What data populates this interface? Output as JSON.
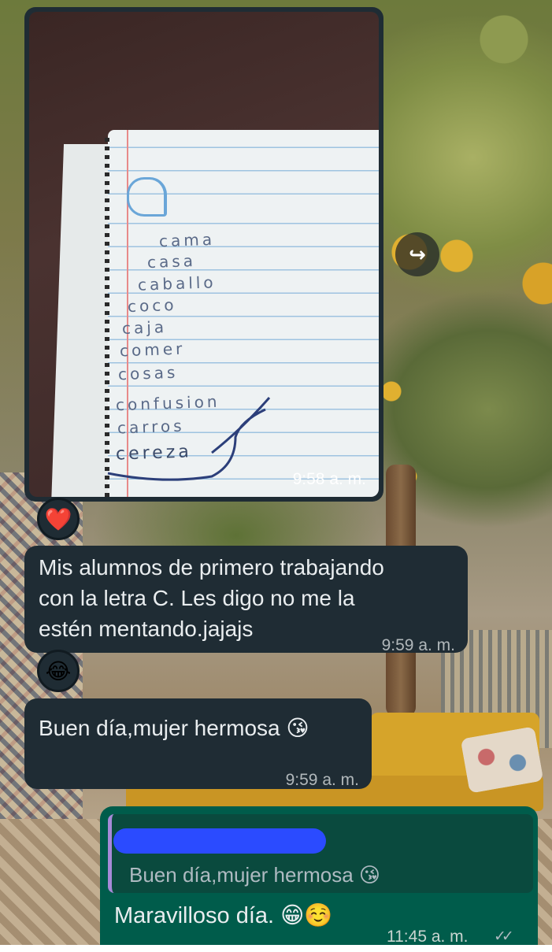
{
  "wallpaper": {
    "description_icon": "garden-courtyard-wallpaper"
  },
  "messages": [
    {
      "type": "image",
      "direction": "incoming",
      "time": "9:58 a. m.",
      "notebook_words": [
        "cama",
        "casa",
        "caballo",
        "coco",
        "caja",
        "comer",
        "cosas",
        "confusion",
        "carros",
        "cereza"
      ],
      "reaction": "❤️",
      "forward_icon": "forward-icon"
    },
    {
      "type": "text",
      "direction": "incoming",
      "lines": [
        "Mis alumnos de primero trabajando",
        "con la letra C. Les digo no me la",
        "estén mentando.jajajs"
      ],
      "time": "9:59 a. m.",
      "reaction": "😂"
    },
    {
      "type": "text",
      "direction": "incoming",
      "text": "Buen día,mujer hermosa 😘",
      "time": "9:59 a. m."
    },
    {
      "type": "reply",
      "direction": "outgoing",
      "quoted_text": "Buen día,mujer hermosa 😘",
      "text": "Maravilloso día. 😁☺️",
      "time": "11:45 a. m.",
      "status": "✓✓"
    }
  ]
}
